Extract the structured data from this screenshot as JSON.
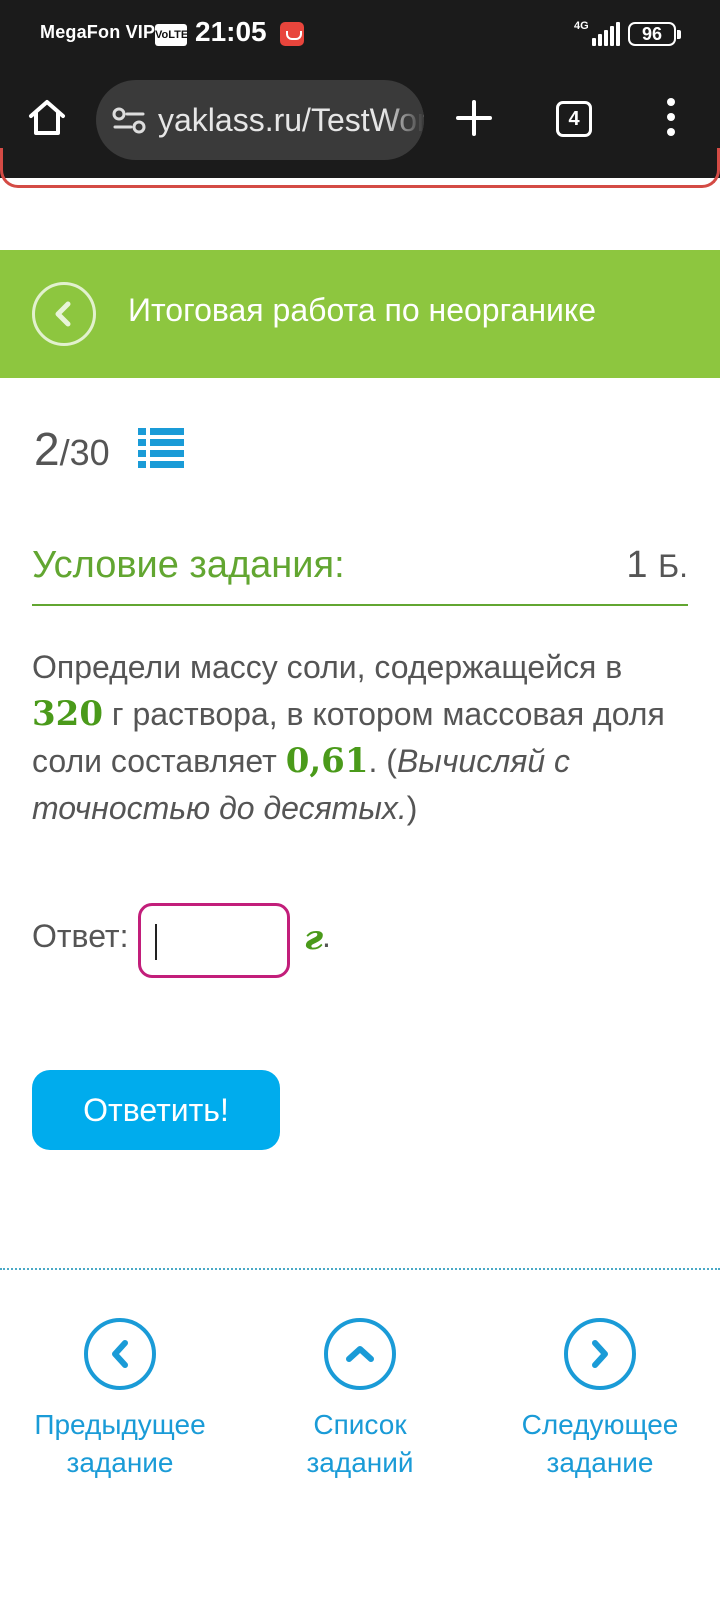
{
  "status_bar": {
    "carrier": "MegaFon VIP",
    "volte": "VoLTE",
    "time": "21:05",
    "network": "4G",
    "battery": "96"
  },
  "browser": {
    "url": "yaklass.ru/TestWork",
    "tab_count": "4",
    "icons": [
      "home-icon",
      "site-settings-icon",
      "new-tab-icon",
      "tab-switcher-icon",
      "overflow-menu-icon"
    ]
  },
  "header": {
    "title": "Итоговая работа по неорганике"
  },
  "progress": {
    "current": "2",
    "total": "/30"
  },
  "task": {
    "condition_title": "Условие задания:",
    "points_value": "1",
    "points_unit": "Б.",
    "text_part1": "Определи массу соли, содержащейся в ",
    "value_mass": "320",
    "text_part2": " г раствора, в котором массовая доля соли составляет ",
    "value_fraction": "0,61",
    "text_part3": ". (",
    "hint": "Вычисляй с точностью до десятых.",
    "text_part4": ")"
  },
  "answer": {
    "label": "Ответ:",
    "value": "",
    "unit": "г",
    "after_unit": "."
  },
  "submit": {
    "label": "Ответить!"
  },
  "bottom_nav": {
    "prev": "Предыдущее задание",
    "list": "Список заданий",
    "next": "Следующее задание"
  },
  "colors": {
    "header_green": "#8dc63f",
    "title_green": "#62a631",
    "accent_blue": "#00aced",
    "input_border": "#c21e7a"
  }
}
